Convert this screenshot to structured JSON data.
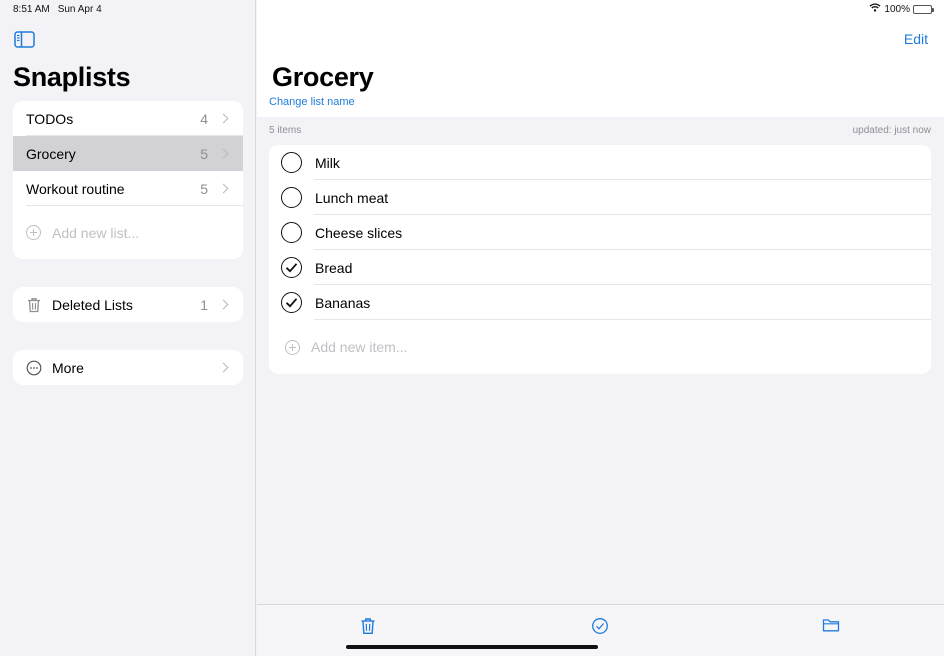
{
  "status_bar": {
    "time": "8:51 AM",
    "date": "Sun Apr 4",
    "battery": "100%",
    "battery_level": 1.0
  },
  "sidebar": {
    "title": "Snaplists",
    "lists": [
      {
        "label": "TODOs",
        "count": "4",
        "selected": false
      },
      {
        "label": "Grocery",
        "count": "5",
        "selected": true
      },
      {
        "label": "Workout routine",
        "count": "5",
        "selected": false
      }
    ],
    "add_list_placeholder": "Add new list...",
    "deleted": {
      "label": "Deleted Lists",
      "count": "1"
    },
    "more": {
      "label": "More"
    }
  },
  "main": {
    "edit_label": "Edit",
    "title": "Grocery",
    "change_name_label": "Change list name",
    "item_count": "5 items",
    "updated": "updated: just now",
    "items": [
      {
        "label": "Milk",
        "checked": false
      },
      {
        "label": "Lunch meat",
        "checked": false
      },
      {
        "label": "Cheese slices",
        "checked": false
      },
      {
        "label": "Bread",
        "checked": true
      },
      {
        "label": "Bananas",
        "checked": true
      }
    ],
    "add_item_placeholder": "Add new item..."
  },
  "toolbar": {
    "icons": [
      "trash-icon",
      "checkmark-circle-icon",
      "folder-icon"
    ]
  },
  "colors": {
    "accent": "#1f7bd9",
    "background": "#f2f2f7",
    "selected_row": "#d1d1d6"
  }
}
